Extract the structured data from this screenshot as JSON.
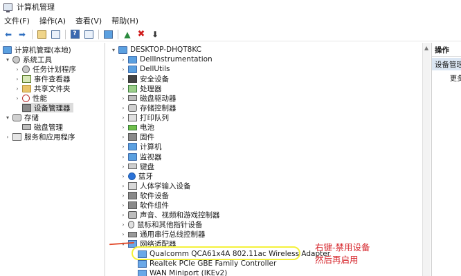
{
  "window": {
    "title": "计算机管理"
  },
  "menu": {
    "file": "文件(F)",
    "action": "操作(A)",
    "view": "查看(V)",
    "help": "帮助(H)"
  },
  "toolbar_icons": [
    "back-arrow-icon",
    "forward-arrow-icon",
    "up-folder-icon",
    "show-tree-icon",
    "help-icon",
    "properties-icon",
    "monitor-icon",
    "enable-device-icon",
    "delete-x-icon",
    "download-arrow-icon"
  ],
  "left_tree": [
    {
      "label": "计算机管理(本地)",
      "icon": "computer-management-icon",
      "level": 0,
      "expander": ""
    },
    {
      "label": "系统工具",
      "icon": "tools-icon",
      "level": 1,
      "expander": "▾"
    },
    {
      "label": "任务计划程序",
      "icon": "clock-icon",
      "level": 2,
      "expander": "›"
    },
    {
      "label": "事件查看器",
      "icon": "event-log-icon",
      "level": 2,
      "expander": "›"
    },
    {
      "label": "共享文件夹",
      "icon": "shared-folder-icon",
      "level": 2,
      "expander": "›"
    },
    {
      "label": "性能",
      "icon": "no-entry-icon",
      "level": 2,
      "expander": "›"
    },
    {
      "label": "设备管理器",
      "icon": "device-manager-icon",
      "level": 2,
      "expander": "",
      "selected": true
    },
    {
      "label": "存储",
      "icon": "storage-icon",
      "level": 1,
      "expander": "▾"
    },
    {
      "label": "磁盘管理",
      "icon": "disk-icon",
      "level": 2,
      "expander": ""
    },
    {
      "label": "服务和应用程序",
      "icon": "services-icon",
      "level": 1,
      "expander": "›"
    }
  ],
  "device_tree": {
    "root": "DESKTOP-DHQT8KC",
    "categories": [
      {
        "label": "DellInstrumentation",
        "icon": "monitor-icon"
      },
      {
        "label": "DellUtils",
        "icon": "monitor-icon"
      },
      {
        "label": "安全设备",
        "icon": "security-chip-icon"
      },
      {
        "label": "处理器",
        "icon": "processor-icon"
      },
      {
        "label": "磁盘驱动器",
        "icon": "disk-drive-icon"
      },
      {
        "label": "存储控制器",
        "icon": "storage-controller-icon"
      },
      {
        "label": "打印队列",
        "icon": "printer-icon"
      },
      {
        "label": "电池",
        "icon": "battery-icon"
      },
      {
        "label": "固件",
        "icon": "firmware-icon"
      },
      {
        "label": "计算机",
        "icon": "computer-icon"
      },
      {
        "label": "监视器",
        "icon": "monitor-icon"
      },
      {
        "label": "键盘",
        "icon": "keyboard-icon"
      },
      {
        "label": "蓝牙",
        "icon": "bluetooth-icon"
      },
      {
        "label": "人体学输入设备",
        "icon": "hid-icon"
      },
      {
        "label": "软件设备",
        "icon": "software-device-icon"
      },
      {
        "label": "软件组件",
        "icon": "software-component-icon"
      },
      {
        "label": "声音、视频和游戏控制器",
        "icon": "sound-icon"
      },
      {
        "label": "鼠标和其他指针设备",
        "icon": "mouse-icon"
      },
      {
        "label": "通用串行总线控制器",
        "icon": "usb-icon"
      },
      {
        "label": "网络适配器",
        "icon": "network-adapter-icon",
        "expanded": true
      }
    ],
    "network_adapters": [
      {
        "label": "Qualcomm QCA61x4A 802.11ac Wireless Adapter",
        "icon": "network-adapter-icon"
      },
      {
        "label": "Realtek PCIe GBE Family Controller",
        "icon": "network-adapter-icon"
      },
      {
        "label": "WAN Miniport (IKEv2)",
        "icon": "network-adapter-icon"
      }
    ]
  },
  "actions_pane": {
    "header": "操作",
    "selected": "设备管理器",
    "more": "更多操作"
  },
  "annotation": {
    "line1": "右键-禁用设备",
    "line2": "然后再启用"
  },
  "colors": {
    "highlight": "#f4f13a",
    "annotation": "#d6262c",
    "selection": "#dcdcdc"
  }
}
